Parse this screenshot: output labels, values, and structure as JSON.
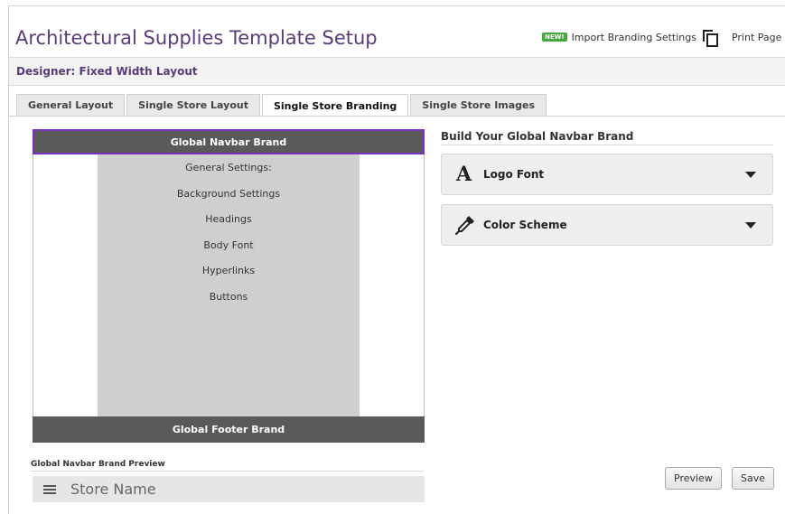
{
  "page": {
    "title": "Architectural Supplies Template Setup",
    "new_badge": "NEW!",
    "import_label": "Import Branding Settings",
    "print_label": "Print Page"
  },
  "designer": {
    "label": "Designer: Fixed Width Layout"
  },
  "tabs": [
    {
      "label": "General Layout",
      "active": false
    },
    {
      "label": "Single Store Layout",
      "active": false
    },
    {
      "label": "Single Store Branding",
      "active": true
    },
    {
      "label": "Single Store Images",
      "active": false
    }
  ],
  "layout_preview": {
    "navbar_label": "Global Navbar Brand",
    "settings": [
      "General Settings:",
      "Background Settings",
      "Headings",
      "Body Font",
      "Hyperlinks",
      "Buttons"
    ],
    "footer_label": "Global Footer Brand"
  },
  "navbar_preview": {
    "title": "Global Navbar Brand Preview",
    "store_name": "Store Name"
  },
  "builder": {
    "title": "Build Your Global Navbar Brand",
    "sections": [
      {
        "label": "Logo Font",
        "icon": "font-icon"
      },
      {
        "label": "Color Scheme",
        "icon": "eyedropper-icon"
      }
    ]
  },
  "actions": {
    "preview_label": "Preview",
    "save_label": "Save"
  },
  "colors": {
    "title_purple": "#5a3b7a",
    "navbar_highlight": "#7b2fbe",
    "dark_bar": "#5a5a5a",
    "settings_bg": "#cfcfcf",
    "new_badge_green": "#44a83f"
  }
}
